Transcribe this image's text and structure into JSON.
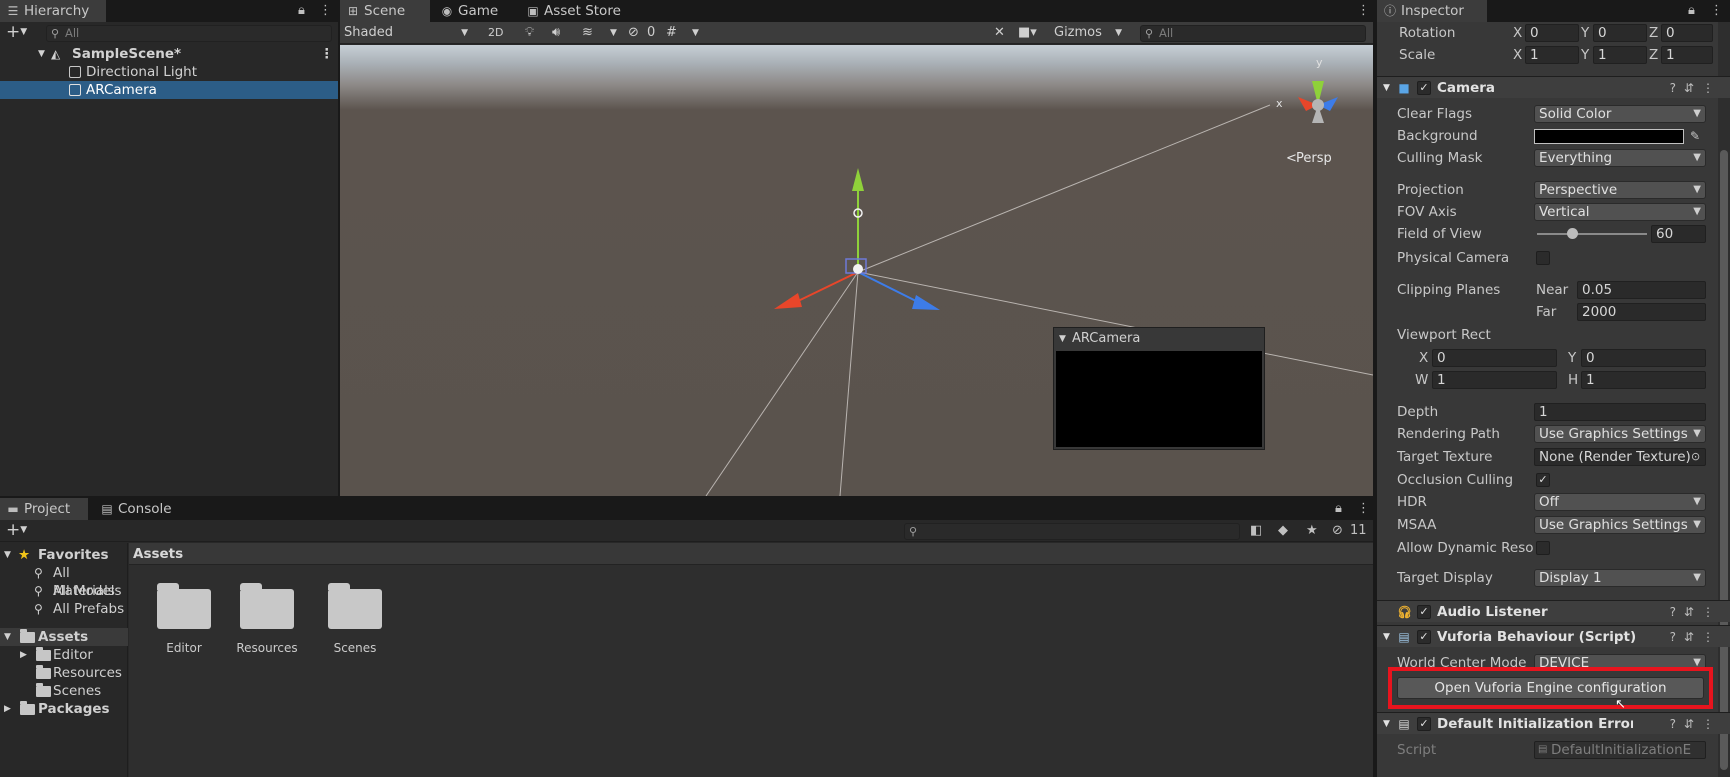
{
  "hierarchy": {
    "tab": "Hierarchy",
    "search_placeholder": "All",
    "scene": "SampleScene*",
    "items": [
      "Directional Light",
      "ARCamera"
    ]
  },
  "scene": {
    "tabs": [
      "Scene",
      "Game",
      "Asset Store"
    ],
    "shading": "Shaded",
    "mode_2d": "2D",
    "hidden_count": "0",
    "gizmos": "Gizmos",
    "search_placeholder": "All",
    "persp": "Persp",
    "axis_x": "x",
    "axis_y": "y",
    "preview_title": "ARCamera"
  },
  "project": {
    "tabs": [
      "Project",
      "Console"
    ],
    "favorites_label": "Favorites",
    "favorites": [
      "All Materials",
      "All Models",
      "All Prefabs"
    ],
    "assets_label": "Assets",
    "asset_folders": [
      "Editor",
      "Resources",
      "Scenes"
    ],
    "packages_label": "Packages",
    "breadcrumb": "Assets",
    "grid_folders": [
      "Editor",
      "Resources",
      "Scenes"
    ],
    "hidden_count": "11"
  },
  "inspector": {
    "tab": "Inspector",
    "rotation": {
      "label": "Rotation",
      "x": "0",
      "y": "0",
      "z": "0"
    },
    "scale": {
      "label": "Scale",
      "x": "1",
      "y": "1",
      "z": "1"
    },
    "camera": {
      "title": "Camera",
      "clear_flags": {
        "label": "Clear Flags",
        "value": "Solid Color"
      },
      "background": {
        "label": "Background",
        "color": "#000000"
      },
      "culling_mask": {
        "label": "Culling Mask",
        "value": "Everything"
      },
      "projection": {
        "label": "Projection",
        "value": "Perspective"
      },
      "fov_axis": {
        "label": "FOV Axis",
        "value": "Vertical"
      },
      "field_of_view": {
        "label": "Field of View",
        "value": "60"
      },
      "physical_camera": {
        "label": "Physical Camera"
      },
      "clipping_planes": {
        "label": "Clipping Planes",
        "near_label": "Near",
        "near": "0.05",
        "far_label": "Far",
        "far": "2000"
      },
      "viewport_rect": {
        "label": "Viewport Rect",
        "x_label": "X",
        "x": "0",
        "y_label": "Y",
        "y": "0",
        "w_label": "W",
        "w": "1",
        "h_label": "H",
        "h": "1"
      },
      "depth": {
        "label": "Depth",
        "value": "1"
      },
      "rendering_path": {
        "label": "Rendering Path",
        "value": "Use Graphics Settings"
      },
      "target_texture": {
        "label": "Target Texture",
        "value": "None (Render Texture)"
      },
      "occlusion_culling": {
        "label": "Occlusion Culling"
      },
      "hdr": {
        "label": "HDR",
        "value": "Off"
      },
      "msaa": {
        "label": "MSAA",
        "value": "Use Graphics Settings"
      },
      "allow_dynamic": {
        "label": "Allow Dynamic Reso"
      },
      "target_display": {
        "label": "Target Display",
        "value": "Display 1"
      }
    },
    "audio_listener": {
      "title": "Audio Listener"
    },
    "vuforia": {
      "title": "Vuforia Behaviour (Script)",
      "world_center_label": "World Center Mode",
      "world_center_value": "DEVICE",
      "open_config_button": "Open Vuforia Engine configuration"
    },
    "default_init": {
      "title": "Default Initialization Error Har",
      "script_label": "Script",
      "script_value": "DefaultInitializationE"
    },
    "highlight_color": "#e8141e"
  }
}
